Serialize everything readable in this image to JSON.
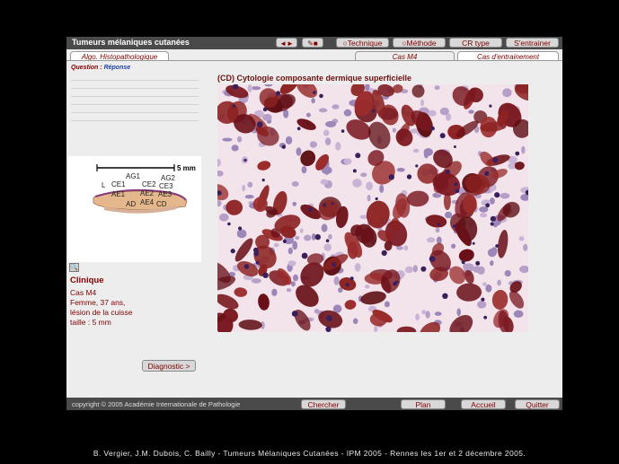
{
  "app": {
    "title": "Tumeurs mélaniques cutanées"
  },
  "toolbar": {
    "arrows_label": "◄►",
    "view_label": "",
    "technique_label": "Technique",
    "methode_label": "Méthode",
    "crtype_label": "CR type",
    "entrainer_label": "S'entrainer"
  },
  "tabs": {
    "algo": "Algo. Histopathologique",
    "cas": "Cas M4",
    "entrainement": "Cas d'entrainement"
  },
  "question": {
    "q": "Question",
    "sep": " : ",
    "r": "Réponse"
  },
  "image": {
    "title": "(CD) Cytologie composante dermique superficielle"
  },
  "overview": {
    "scale": "5 mm",
    "labels": [
      "AG1",
      "AG2",
      "L",
      "CE1",
      "CE2",
      "CE3",
      "AE1",
      "AE2",
      "AE3",
      "AD",
      "AE4",
      "CD"
    ]
  },
  "clinique": {
    "title": "Clinique",
    "line1": "Cas M4",
    "line2": "Femme, 37 ans,",
    "line3": "lésion de la cuisse",
    "line4": "taille : 5 mm"
  },
  "diagnostic_label": "Diagnostic >",
  "bottom": {
    "copyright": "copyright © 2005 Académie Internationale de Pathologie",
    "chercher": "Chercher",
    "plan": "Plan",
    "accueil": "Accueil",
    "quitter": "Quitter"
  },
  "caption": "B. Vergier, J.M. Dubois, C. Bailly - Tumeurs Mélaniques Cutanées - IPM 2005 - Rennes les 1er et 2 décembre 2005.",
  "colors": {
    "accent": "#800000",
    "bar": "#4a4a4a",
    "pigment": "#7a1820"
  }
}
